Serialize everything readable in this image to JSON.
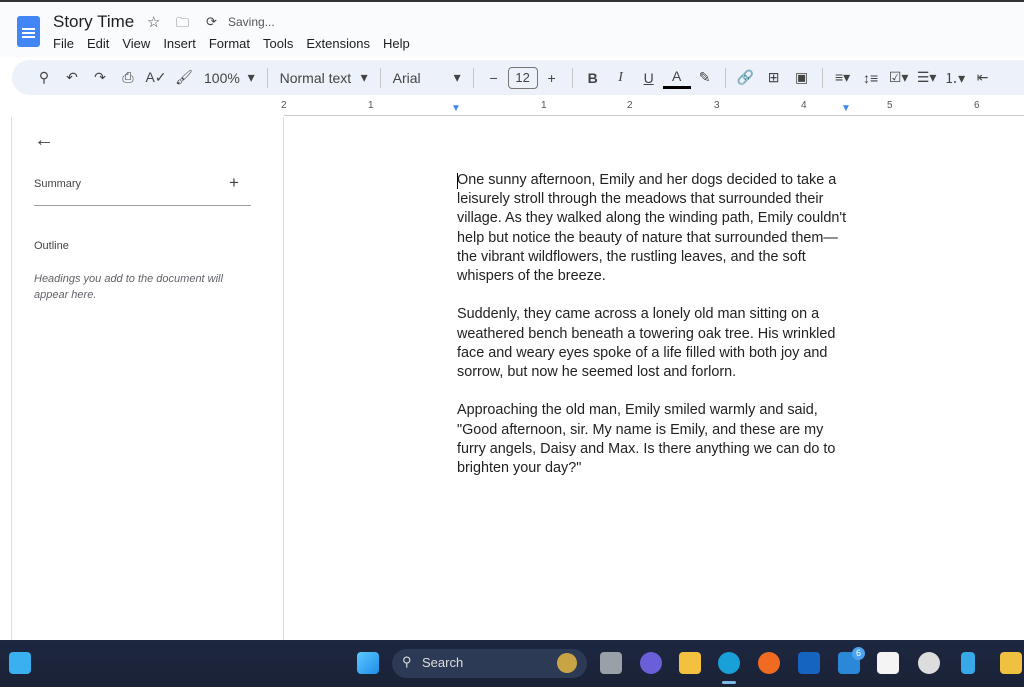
{
  "header": {
    "title": "Story Time",
    "status": "Saving...",
    "menu": [
      "File",
      "Edit",
      "View",
      "Insert",
      "Format",
      "Tools",
      "Extensions",
      "Help"
    ]
  },
  "toolbar": {
    "zoom": "100%",
    "style": "Normal text",
    "font": "Arial",
    "font_size": "12",
    "text_color": "#000000"
  },
  "ruler": {
    "numbers": [
      "2",
      "1",
      "1",
      "2",
      "3",
      "4",
      "5",
      "6"
    ]
  },
  "sidebar": {
    "summary_label": "Summary",
    "outline_label": "Outline",
    "outline_hint": "Headings you add to the document will appear here."
  },
  "document": {
    "paragraphs": [
      "One sunny afternoon, Emily and her dogs decided to take a leisurely stroll through the meadows that surrounded their village. As they walked along the winding path, Emily couldn't help but notice the beauty of nature that surrounded them—the vibrant wildflowers, the rustling leaves, and the soft whispers of the breeze.",
      "Suddenly, they came across a lonely old man sitting on a weathered bench beneath a towering oak tree. His wrinkled face and weary eyes spoke of a life filled with both joy and sorrow, but now he seemed lost and forlorn.",
      "Approaching the old man, Emily smiled warmly and said, \"Good afternoon, sir. My name is Emily, and these are my furry angels, Daisy and Max. Is there anything we can do to brighten your day?\""
    ]
  },
  "taskbar": {
    "search_label": "Search",
    "mail_badge": "6",
    "apps": [
      "start",
      "widgets",
      "task-view",
      "teams",
      "file-explorer",
      "edge",
      "firefox",
      "outlook",
      "mail",
      "store",
      "xbox",
      "phone",
      "onedrive-folder"
    ]
  }
}
